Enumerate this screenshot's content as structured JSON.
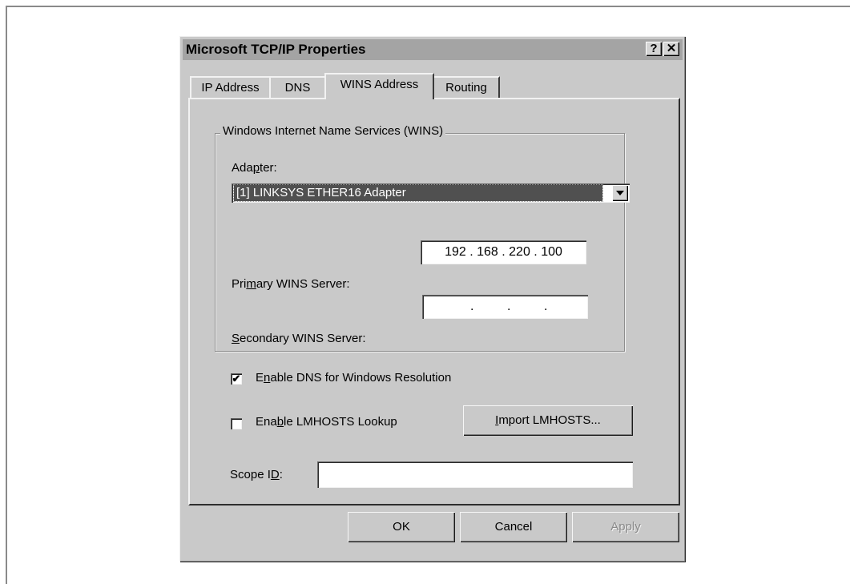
{
  "window": {
    "title": "Microsoft TCP/IP Properties",
    "help_glyph": "?",
    "close_glyph": "✕"
  },
  "tabs": [
    {
      "label": "IP Address",
      "active": false
    },
    {
      "label": "DNS",
      "active": false
    },
    {
      "label": "WINS Address",
      "active": true
    },
    {
      "label": "Routing",
      "active": false
    }
  ],
  "wins_group": {
    "legend": "Windows Internet Name Services (WINS)",
    "adapter_label_pre": "Ada",
    "adapter_label_ul": "p",
    "adapter_label_post": "ter:",
    "adapter_value": "[1] LINKSYS ETHER16 Adapter",
    "primary_label_pre": "Pri",
    "primary_label_ul": "m",
    "primary_label_post": "ary WINS Server:",
    "primary_value": "192 . 168 . 220 . 100",
    "secondary_label_ul": "S",
    "secondary_label_post": "econdary WINS Server:",
    "secondary_value": ""
  },
  "options": {
    "dns_checked": true,
    "dns_check_glyph": "✔",
    "dns_label_pre": "E",
    "dns_label_ul": "n",
    "dns_label_post": "able DNS for Windows Resolution",
    "lmhosts_checked": false,
    "lmhosts_label_pre": "Ena",
    "lmhosts_label_ul": "b",
    "lmhosts_label_post": "le LMHOSTS Lookup",
    "import_button_ul": "I",
    "import_button_post": "mport LMHOSTS...",
    "scope_label_pre": "Scope I",
    "scope_label_ul": "D",
    "scope_label_post": ":",
    "scope_value": ""
  },
  "buttons": {
    "ok": "OK",
    "cancel": "Cancel",
    "apply": "Apply"
  },
  "colors": {
    "window_bg": "#c9c9c9",
    "titlebar_bg": "#a4a4a4",
    "selection_bg": "#505050"
  },
  "icons": {
    "help": "help-icon",
    "close": "close-icon",
    "dropdown": "chevron-down-icon",
    "check": "checkmark-icon"
  }
}
